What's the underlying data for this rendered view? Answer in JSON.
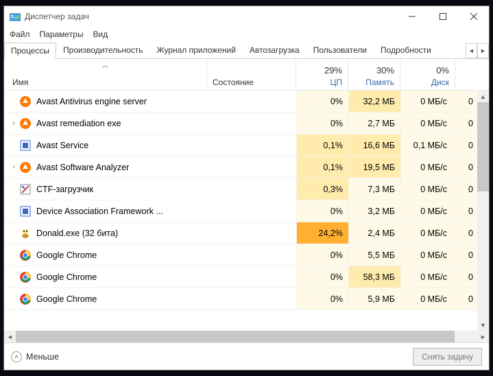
{
  "window": {
    "title": "Диспетчер задач"
  },
  "menu": {
    "file": "Файл",
    "options": "Параметры",
    "view": "Вид"
  },
  "tabs": {
    "processes": "Процессы",
    "performance": "Производительность",
    "app_history": "Журнал приложений",
    "startup": "Автозагрузка",
    "users": "Пользователи",
    "details": "Подробности"
  },
  "columns": {
    "name": "Имя",
    "state": "Состояние",
    "cpu_pct": "29%",
    "cpu_label": "ЦП",
    "mem_pct": "30%",
    "mem_label": "Память",
    "disk_pct": "0%",
    "disk_label": "Диск"
  },
  "rows": [
    {
      "expand": "",
      "icon": "avast",
      "name": "Avast Antivirus engine server",
      "cpu": "0%",
      "cpu_heat": "heat0",
      "mem": "32,2 МБ",
      "mem_heat": "heat1",
      "disk": "0 МБ/с",
      "disk_heat": "heat0",
      "net": "0"
    },
    {
      "expand": "›",
      "icon": "avast",
      "name": "Avast remediation exe",
      "cpu": "0%",
      "cpu_heat": "heat0",
      "mem": "2,7 МБ",
      "mem_heat": "heat0",
      "disk": "0 МБ/с",
      "disk_heat": "heat0",
      "net": "0"
    },
    {
      "expand": "",
      "icon": "generic-blue",
      "name": "Avast Service",
      "cpu": "0,1%",
      "cpu_heat": "heat1",
      "mem": "16,6 МБ",
      "mem_heat": "heat1",
      "disk": "0,1 МБ/с",
      "disk_heat": "heat0",
      "net": "0"
    },
    {
      "expand": "›",
      "icon": "avast",
      "name": "Avast Software Analyzer",
      "cpu": "0,1%",
      "cpu_heat": "heat1",
      "mem": "19,5 МБ",
      "mem_heat": "heat1",
      "disk": "0 МБ/с",
      "disk_heat": "heat0",
      "net": "0"
    },
    {
      "expand": "",
      "icon": "ctf",
      "name": "CTF-загрузчик",
      "cpu": "0,3%",
      "cpu_heat": "heat1",
      "mem": "7,3 МБ",
      "mem_heat": "heat0",
      "disk": "0 МБ/с",
      "disk_heat": "heat0",
      "net": "0"
    },
    {
      "expand": "",
      "icon": "generic-blue",
      "name": "Device Association Framework ...",
      "cpu": "0%",
      "cpu_heat": "heat0",
      "mem": "3,2 МБ",
      "mem_heat": "heat0",
      "disk": "0 МБ/с",
      "disk_heat": "heat0",
      "net": "0"
    },
    {
      "expand": "",
      "icon": "donald",
      "name": "Donald.exe (32 бита)",
      "cpu": "24,2%",
      "cpu_heat": "heat3",
      "mem": "2,4 МБ",
      "mem_heat": "heat0",
      "disk": "0 МБ/с",
      "disk_heat": "heat0",
      "net": "0"
    },
    {
      "expand": "",
      "icon": "chrome",
      "name": "Google Chrome",
      "cpu": "0%",
      "cpu_heat": "heat0",
      "mem": "5,5 МБ",
      "mem_heat": "heat0",
      "disk": "0 МБ/с",
      "disk_heat": "heat0",
      "net": "0"
    },
    {
      "expand": "",
      "icon": "chrome",
      "name": "Google Chrome",
      "cpu": "0%",
      "cpu_heat": "heat0",
      "mem": "58,3 МБ",
      "mem_heat": "heat1",
      "disk": "0 МБ/с",
      "disk_heat": "heat0",
      "net": "0"
    },
    {
      "expand": "",
      "icon": "chrome",
      "name": "Google Chrome",
      "cpu": "0%",
      "cpu_heat": "heat0",
      "mem": "5,9 МБ",
      "mem_heat": "heat0",
      "disk": "0 МБ/с",
      "disk_heat": "heat0",
      "net": "0"
    }
  ],
  "footer": {
    "fewer": "Меньше",
    "end_task": "Снять задачу"
  }
}
